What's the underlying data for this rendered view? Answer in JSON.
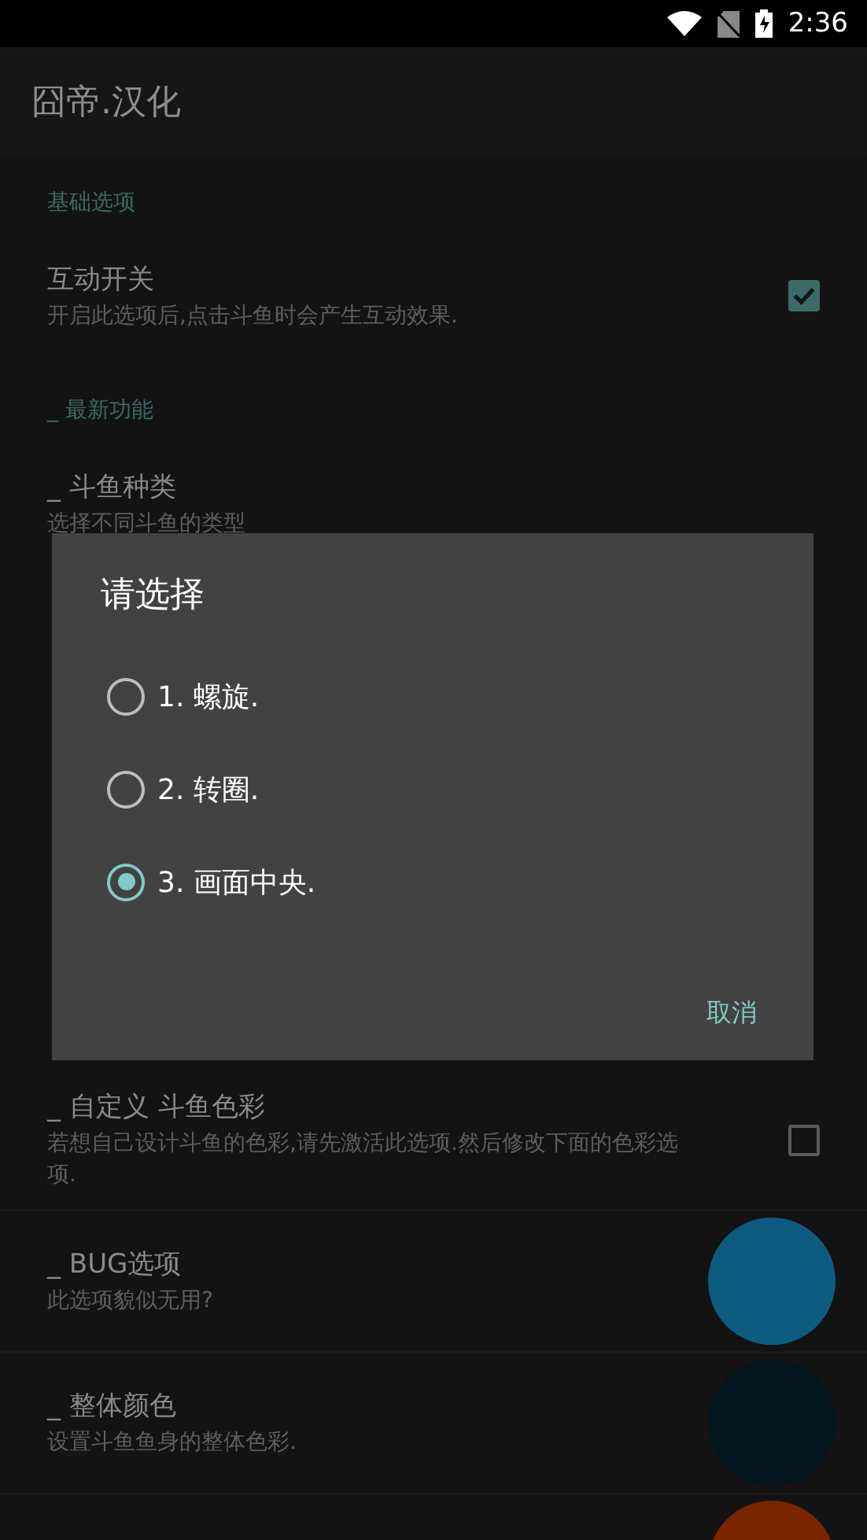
{
  "status_bar": {
    "time": "2:36"
  },
  "app_bar": {
    "title": "囧帝.汉化"
  },
  "sections": [
    {
      "header": "基础选项",
      "items": [
        {
          "kind": "checkbox",
          "title": "互动开关",
          "summary": "开启此选项后,点击斗鱼时会产生互动效果.",
          "checked": true
        }
      ]
    },
    {
      "header": "_ 最新功能",
      "items": [
        {
          "kind": "plain",
          "title": "_ 斗鱼种类",
          "summary": "选择不同斗鱼的类型"
        }
      ]
    }
  ],
  "lower_items": [
    {
      "kind": "checkbox",
      "title": "_ 自定义 斗鱼色彩",
      "summary": "若想自己设计斗鱼的色彩,请先激活此选项.然后修改下面的色彩选项.",
      "checked": false
    },
    {
      "kind": "color",
      "title": "_ BUG选项",
      "summary": "此选项貌似无用?",
      "color": "#0e5b80"
    },
    {
      "kind": "color",
      "title": "_ 整体颜色",
      "summary": "设置斗鱼鱼身的整体色彩.",
      "color": "#03161d"
    },
    {
      "kind": "color",
      "color": "#7a2500"
    }
  ],
  "dialog": {
    "title": "请选择",
    "options": [
      {
        "label": "1. 螺旋.",
        "selected": false
      },
      {
        "label": "2. 转圈.",
        "selected": false
      },
      {
        "label": "3. 画面中央.",
        "selected": true
      }
    ],
    "cancel": "取消"
  }
}
